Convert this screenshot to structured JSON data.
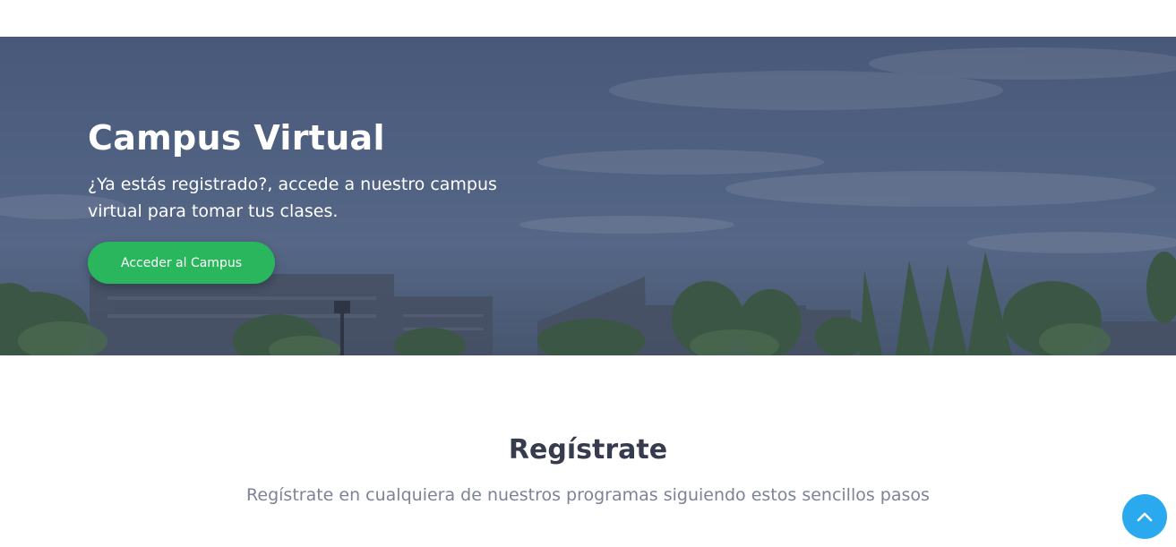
{
  "hero": {
    "title": "Campus Virtual",
    "subtitle": "¿Ya estás registrado?, accede a nuestro campus virtual para tomar tus clases.",
    "cta_label": "Acceder al Campus",
    "overlay_color": "#4d5d7e",
    "cta_color": "#2ab65d"
  },
  "register": {
    "title": "Regístrate",
    "subtitle": "Regístrate en cualquiera de nuestros programas siguiendo estos sencillos pasos"
  },
  "scroll_top": {
    "icon": "chevron-up-icon",
    "color": "#2aa9ef"
  }
}
